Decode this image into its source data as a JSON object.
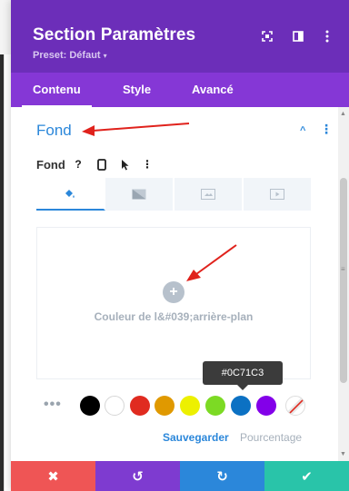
{
  "header": {
    "title": "Section Paramètres",
    "preset_label": "Preset: Défaut",
    "preset_caret": "▾",
    "icons": [
      "expand-icon",
      "split-view-icon",
      "more-vertical-icon"
    ]
  },
  "tabs": [
    {
      "label": "Contenu",
      "active": true
    },
    {
      "label": "Style",
      "active": false
    },
    {
      "label": "Avancé",
      "active": false
    }
  ],
  "section": {
    "title": "Fond",
    "toggle": "^",
    "more": "⋮"
  },
  "field": {
    "label": "Fond",
    "help_glyph": "?",
    "more_glyph": "⋮"
  },
  "background_tabs": [
    "color",
    "gradient",
    "image",
    "video"
  ],
  "preview": {
    "add_glyph": "+",
    "label": "Couleur de l&#039;arrière-plan"
  },
  "tooltip": {
    "text": "#0C71C3"
  },
  "swatches": {
    "more_glyph": "•••",
    "colors": [
      "#000000",
      "#ffffff",
      "#e02b20",
      "#e09900",
      "#edf000",
      "#7cda24",
      "#0c71c3",
      "#8300e9"
    ],
    "selected": "#0C71C3"
  },
  "actions": {
    "save_label": "Sauvegarder",
    "percent_label": "Pourcentage"
  },
  "footer": {
    "buttons": [
      {
        "name": "cancel",
        "glyph": "✖",
        "color": "#ef5555"
      },
      {
        "name": "undo",
        "glyph": "↺",
        "color": "#7e3bd0"
      },
      {
        "name": "redo",
        "glyph": "↻",
        "color": "#2b87da"
      },
      {
        "name": "save",
        "glyph": "✔",
        "color": "#29c4a9"
      }
    ]
  },
  "colors": {
    "header": "#6c2eb9",
    "tabs": "#8537d6",
    "accent": "#2b87da",
    "annotation_arrow": "#e0221c"
  }
}
